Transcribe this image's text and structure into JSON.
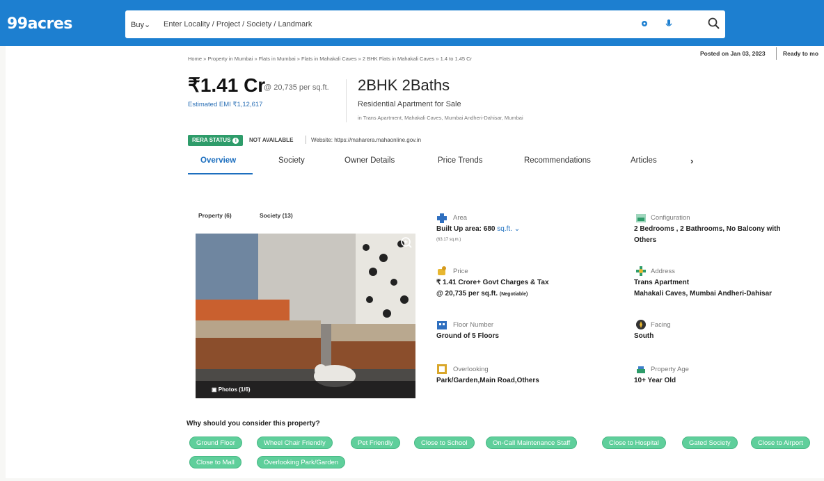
{
  "header": {
    "logo": "99acres",
    "buy_label": "Buy",
    "search_placeholder": "Enter Locality / Project / Society / Landmark"
  },
  "breadcrumb": "Home » Property in Mumbai » Flats in Mumbai » Flats in Mahakali Caves » 2 BHK Flats in Mahakali Caves » 1.4 to 1.45 Cr",
  "posted": "Posted on Jan 03, 2023",
  "ready": "Ready to mo",
  "price": "₹1.41 Cr",
  "per_sqft": "@ 20,735 per sq.ft.",
  "emi": "Estimated EMI ₹1,12,617",
  "title": "2BHK 2Baths",
  "property_type": "Residential Apartment for Sale",
  "location_line": "in Trans Apartment, Mahakali Caves, Mumbai Andheri-Dahisar, Mumbai",
  "rera": {
    "badge": "RERA STATUS",
    "status": "NOT AVAILABLE",
    "website": "Website: https://maharera.mahaonline.gov.in"
  },
  "tabs": [
    "Overview",
    "Society",
    "Owner Details",
    "Price Trends",
    "Recommendations",
    "Articles"
  ],
  "gallery_tabs": [
    "Property (6)",
    "Society (13)"
  ],
  "photos_label": "Photos (1/6)",
  "features": {
    "area": {
      "label": "Area",
      "value": "Built Up area: 680",
      "unit": "sq.ft.",
      "sub": "(63.17 sq.m.)"
    },
    "configuration": {
      "label": "Configuration",
      "line1": "2 Bedrooms , 2 Bathrooms, No Balcony with",
      "line2": "Others"
    },
    "price": {
      "label": "Price",
      "line1": "₹ 1.41 Crore+ Govt Charges & Tax",
      "line2": "@ 20,735 per sq.ft.",
      "negotiable": "(Negotiable)"
    },
    "address": {
      "label": "Address",
      "line1": "Trans Apartment",
      "line2": "Mahakali Caves, Mumbai Andheri-Dahisar"
    },
    "floor": {
      "label": "Floor Number",
      "value": "Ground of 5 Floors"
    },
    "facing": {
      "label": "Facing",
      "value": "South"
    },
    "overlooking": {
      "label": "Overlooking",
      "value": "Park/Garden,Main Road,Others"
    },
    "age": {
      "label": "Property Age",
      "value": "10+ Year Old"
    }
  },
  "why_title": "Why should you consider this property?",
  "chips": [
    "Ground Floor",
    "Wheel Chair Friendly",
    "Pet Friendly",
    "Close to School",
    "On-Call Maintenance Staff",
    "Close to Hospital",
    "Gated Society",
    "Close to Airport",
    "Close to Mall",
    "Overlooking Park/Garden"
  ],
  "colors": {
    "brand": "#1d7fd0",
    "chip": "#5fcf9b",
    "rera": "#2e9c6a",
    "link": "#1d6fbf"
  }
}
